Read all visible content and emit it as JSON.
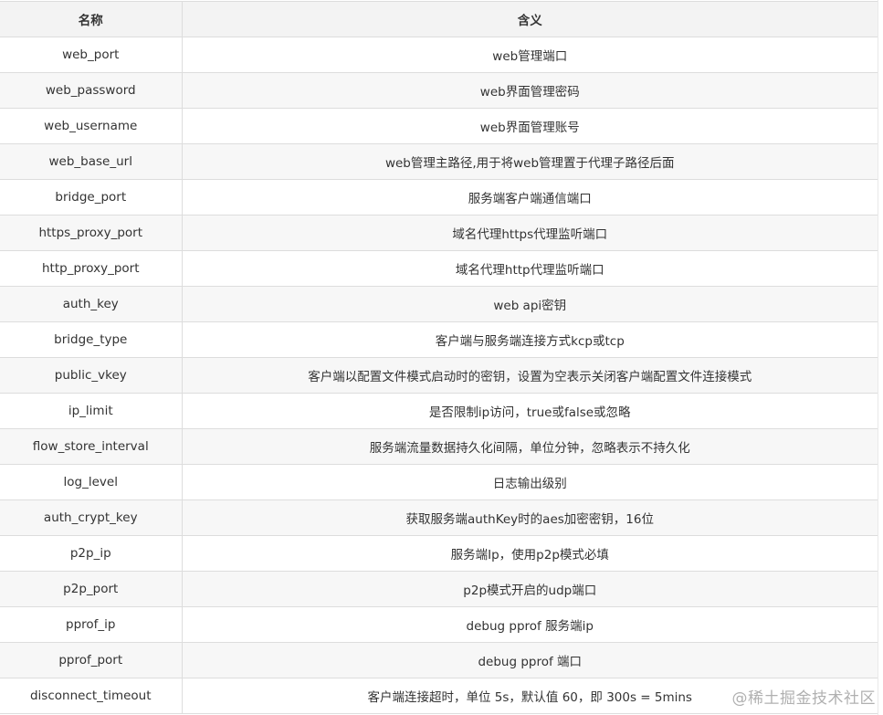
{
  "table": {
    "headers": [
      "名称",
      "含义"
    ],
    "rows": [
      [
        "web_port",
        "web管理端口"
      ],
      [
        "web_password",
        "web界面管理密码"
      ],
      [
        "web_username",
        "web界面管理账号"
      ],
      [
        "web_base_url",
        "web管理主路径,用于将web管理置于代理子路径后面"
      ],
      [
        "bridge_port",
        "服务端客户端通信端口"
      ],
      [
        "https_proxy_port",
        "域名代理https代理监听端口"
      ],
      [
        "http_proxy_port",
        "域名代理http代理监听端口"
      ],
      [
        "auth_key",
        "web api密钥"
      ],
      [
        "bridge_type",
        "客户端与服务端连接方式kcp或tcp"
      ],
      [
        "public_vkey",
        "客户端以配置文件模式启动时的密钥，设置为空表示关闭客户端配置文件连接模式"
      ],
      [
        "ip_limit",
        "是否限制ip访问，true或false或忽略"
      ],
      [
        "flow_store_interval",
        "服务端流量数据持久化间隔，单位分钟，忽略表示不持久化"
      ],
      [
        "log_level",
        "日志输出级别"
      ],
      [
        "auth_crypt_key",
        "获取服务端authKey时的aes加密密钥，16位"
      ],
      [
        "p2p_ip",
        "服务端Ip，使用p2p模式必填"
      ],
      [
        "p2p_port",
        "p2p模式开启的udp端口"
      ],
      [
        "pprof_ip",
        "debug pprof 服务端ip"
      ],
      [
        "pprof_port",
        "debug pprof 端口"
      ],
      [
        "disconnect_timeout",
        "客户端连接超时，单位 5s，默认值 60，即 300s = 5mins"
      ]
    ]
  },
  "watermark": "@稀土掘金技术社区"
}
